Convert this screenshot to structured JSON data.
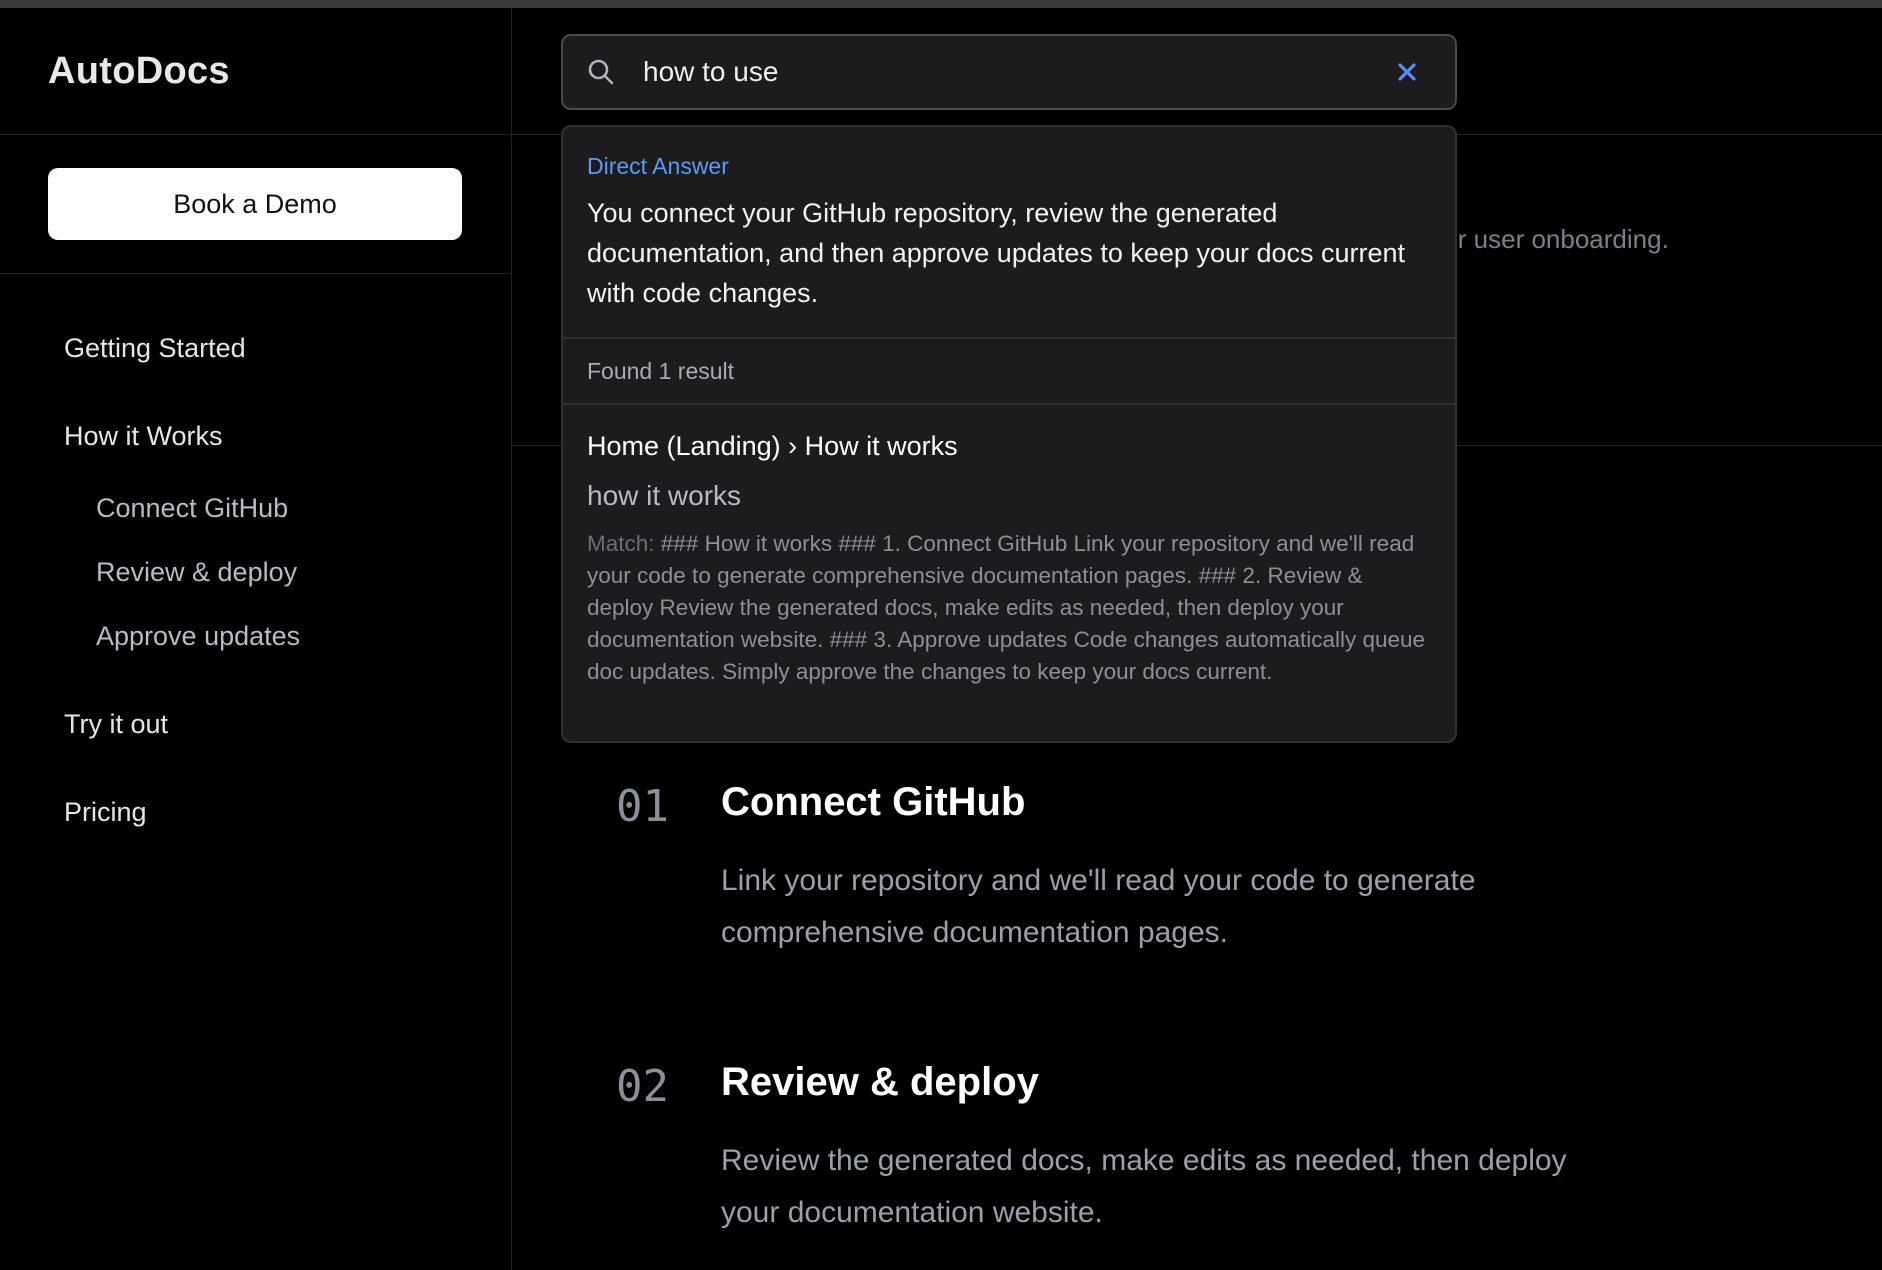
{
  "sidebar": {
    "brand": "AutoDocs",
    "demo_button": "Book a Demo",
    "nav": [
      {
        "label": "Getting Started"
      },
      {
        "label": "How it Works"
      },
      {
        "label": "Connect GitHub"
      },
      {
        "label": "Review & deploy"
      },
      {
        "label": "Approve updates"
      },
      {
        "label": "Try it out"
      },
      {
        "label": "Pricing"
      }
    ]
  },
  "search": {
    "value": "how to use",
    "placeholder": "Search"
  },
  "dropdown": {
    "direct_answer_label": "Direct Answer",
    "direct_answer_text": "You connect your GitHub repository, review the generated documentation, and then approve updates to keep your docs current with code changes.",
    "found_text": "Found 1 result",
    "result": {
      "crumb": "Home (Landing) › How it works",
      "heading": "how it works",
      "match_prefix": "Match:",
      "match_text": "### How it works ### 1. Connect GitHub Link your repository and we'll read your code to generate comprehensive documentation pages. ### 2. Review & deploy Review the generated docs, make edits as needed, then deploy your documentation website. ### 3. Approve updates Code changes automatically queue doc updates. Simply approve the changes to keep your docs current."
    }
  },
  "main": {
    "hero_fragment": "ir user onboarding.",
    "steps": [
      {
        "number": "01",
        "title": "Connect GitHub",
        "description": "Link your repository and we'll read your code to generate comprehensive documentation pages."
      },
      {
        "number": "02",
        "title": "Review & deploy",
        "description": "Review the generated docs, make edits as needed, then deploy your documentation website."
      }
    ]
  },
  "colors": {
    "background": "#000000",
    "accent": "#5a9cf5",
    "button_bg": "#ffffff"
  },
  "icons": {
    "search": "search-icon",
    "clear": "close-icon"
  }
}
